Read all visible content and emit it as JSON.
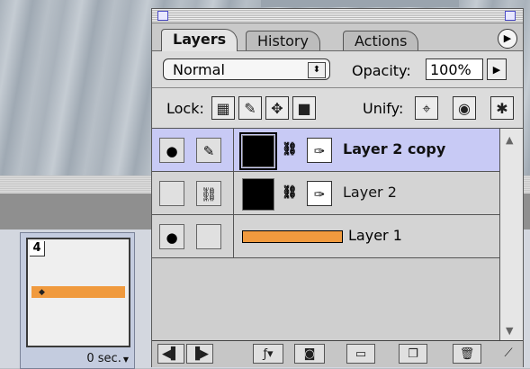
{
  "panel": {
    "tabs": [
      {
        "label": "Layers"
      },
      {
        "label": "History"
      },
      {
        "label": "Actions"
      }
    ],
    "menu_icon": "triangle-right-icon"
  },
  "blend": {
    "mode": "Normal",
    "opacity_label": "Opacity:",
    "opacity_value": "100%"
  },
  "lock": {
    "label": "Lock:",
    "unify_label": "Unify:"
  },
  "layers": [
    {
      "name": "Layer 2 copy",
      "selected": true
    },
    {
      "name": "Layer 2",
      "selected": false
    },
    {
      "name": "Layer 1",
      "selected": false,
      "color": "#f09a3e"
    }
  ],
  "frame": {
    "number": "4",
    "delay": "0 sec."
  },
  "colors": {
    "selection": "#c8caf5",
    "orange": "#f09a3e"
  }
}
